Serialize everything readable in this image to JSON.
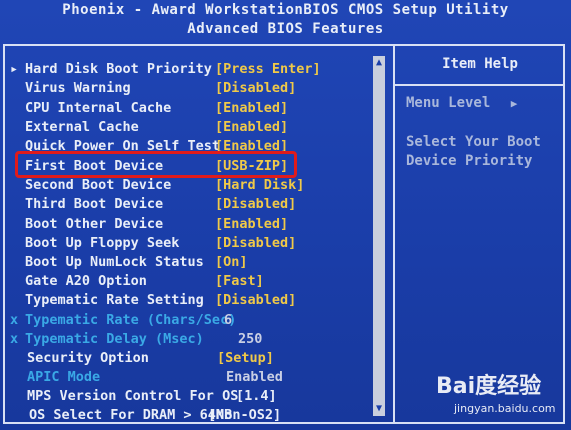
{
  "header": {
    "title": "Phoenix - Award WorkstationBIOS CMOS Setup Utility",
    "subtitle": "Advanced BIOS Features"
  },
  "rows": [
    {
      "marker": "▸",
      "label": "Hard Disk Boot Priority",
      "value": "[Press Enter]"
    },
    {
      "marker": "",
      "label": "Virus Warning",
      "value": "[Disabled]"
    },
    {
      "marker": "",
      "label": "CPU Internal Cache",
      "value": "[Enabled]"
    },
    {
      "marker": "",
      "label": "External Cache",
      "value": "[Enabled]"
    },
    {
      "marker": "",
      "label": "Quick Power On Self Test",
      "value": "[Enabled]"
    },
    {
      "marker": "",
      "label": "First Boot Device",
      "value": "[USB-ZIP]"
    },
    {
      "marker": "",
      "label": "Second Boot Device",
      "value": "[Hard Disk]"
    },
    {
      "marker": "",
      "label": "Third Boot Device",
      "value": "[Disabled]"
    },
    {
      "marker": "",
      "label": "Boot Other Device",
      "value": "[Enabled]"
    },
    {
      "marker": "",
      "label": "Boot Up Floppy Seek",
      "value": "[Disabled]"
    },
    {
      "marker": "",
      "label": "Boot Up NumLock Status",
      "value": "[On]"
    },
    {
      "marker": "",
      "label": "Gate A20 Option",
      "value": "[Fast]"
    },
    {
      "marker": "",
      "label": "Typematic Rate Setting",
      "value": "[Disabled]"
    },
    {
      "marker": "x",
      "label": "Typematic Rate (Chars/Sec)",
      "value": "6"
    },
    {
      "marker": "x",
      "label": "Typematic Delay (Msec)",
      "value": "250"
    },
    {
      "marker": "",
      "label": "Security Option",
      "value": "[Setup]"
    },
    {
      "marker": "",
      "label": "APIC Mode",
      "value": "Enabled"
    },
    {
      "marker": "",
      "label": "MPS Version Control For OS",
      "value": "[1.4]"
    },
    {
      "marker": "",
      "label": "OS Select For DRAM > 64MB",
      "value": "[Non-OS2]"
    }
  ],
  "help": {
    "title": "Item Help",
    "menu_level": "Menu Level",
    "menu_level_arrow": "▶",
    "line1": "Select Your Boot",
    "line2": "Device Priority"
  },
  "watermark": {
    "brand": "Bai度经验",
    "url": "jingyan.baidu.com"
  },
  "colors": {
    "background": "#1a3fa8",
    "value_yellow": "#f0c948",
    "text_white": "#e9eef8",
    "disabled_cyan": "#3aa9e6",
    "highlight_red": "#e01b1b"
  }
}
